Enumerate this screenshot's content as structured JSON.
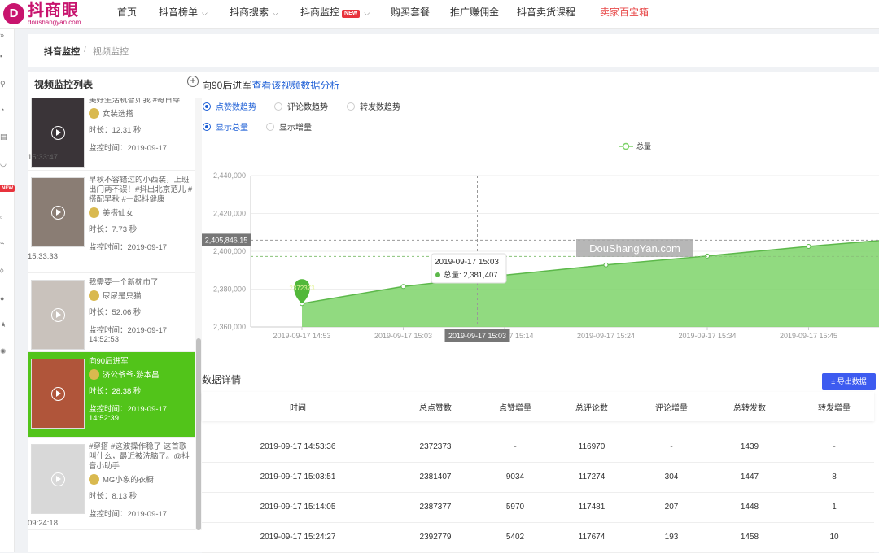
{
  "brand": {
    "name": "抖商眼",
    "sub": "doushangyan.com",
    "mark": "D"
  },
  "nav": [
    {
      "label": "首页",
      "chevron": false
    },
    {
      "label": "抖音榜单",
      "chevron": true
    },
    {
      "label": "抖商搜索",
      "chevron": true
    },
    {
      "label": "抖商监控",
      "chevron": true,
      "badge": "NEW"
    },
    {
      "label": "购买套餐",
      "chevron": false
    },
    {
      "label": "推广赚佣金",
      "chevron": false
    },
    {
      "label": "抖音卖货课程",
      "chevron": false
    },
    {
      "label": "卖家百宝箱",
      "chevron": false,
      "color": "#e84c4c"
    }
  ],
  "rail": {
    "expand": "»",
    "new_badge": "NEW"
  },
  "breadcrumb": {
    "root": "抖音监控",
    "sep": "/",
    "current": "视频监控"
  },
  "list": {
    "title": "视频监控列表",
    "add": "+",
    "items": [
      {
        "desc": "美好生活机智如我 #每日穿…",
        "author": "女装选搭",
        "duration": "时长：12.31 秒",
        "time": "监控时间：2019-09-17",
        "time2": "15:33:47",
        "active": false
      },
      {
        "desc": "早秋不容错过的小西装，上班出门两不误！#抖出北京范儿 #搭配早秋 #一起抖健康",
        "author": "美搭仙女",
        "duration": "时长：7.73 秒",
        "time": "监控时间：2019-09-17",
        "time2": "15:33:33",
        "active": false
      },
      {
        "desc": "我需要一个新枕巾了",
        "author": "尿尿是只猫",
        "duration": "时长：52.06 秒",
        "time": "监控时间：2019-09-17",
        "time2": "14:52:53",
        "active": false
      },
      {
        "desc": "向90后进军",
        "author": "济公爷爷·游本昌",
        "duration": "时长：28.38 秒",
        "time": "监控时间：2019-09-17",
        "time2": "14:52:39",
        "active": true
      },
      {
        "desc": "#穿搭 #这波操作稳了 这首歌叫什么，最近被洗脑了。@抖音小助手",
        "author": "MG小象的衣橱",
        "duration": "时长：8.13 秒",
        "time": "监控时间：2019-09-17",
        "time2": "09:24:18",
        "active": false
      }
    ]
  },
  "main": {
    "video_title": "向90后进军",
    "analysis_link": "查看该视频数据分析",
    "trend_options": [
      {
        "label": "点赞数趋势",
        "on": true
      },
      {
        "label": "评论数趋势",
        "on": false
      },
      {
        "label": "转发数趋势",
        "on": false
      }
    ],
    "mode_options": [
      {
        "label": "显示总量",
        "on": true
      },
      {
        "label": "显示增量",
        "on": false
      }
    ],
    "section_title": "数据详情",
    "export_label": "± 导出数据"
  },
  "chart_data": {
    "type": "area",
    "legend": "总量",
    "legend_position": "top-center",
    "color": "#7ed36a",
    "watermark": "DouShangYan.com",
    "x": [
      "2019-09-17 14:53",
      "2019-09-17 15:03",
      "2019-09-17 15:14",
      "2019-09-17 15:24",
      "2019-09-17 15:34",
      "2019-09-17 15:45"
    ],
    "series": [
      {
        "name": "总量",
        "values": [
          2372373,
          2381407,
          2387377,
          2392779,
          2397500,
          2402600,
          2407000
        ]
      }
    ],
    "x_points": [
      0,
      1,
      2,
      3,
      4,
      5,
      6
    ],
    "ylim": [
      2360000,
      2440000
    ],
    "yticks": [
      "2,440,000",
      "2,420,000",
      "2,400,000",
      "2,380,000",
      "2,360,000"
    ],
    "ytick_values": [
      2440000,
      2420000,
      2400000,
      2380000,
      2360000
    ],
    "tooltip": {
      "title": "2019-09-17 15:03",
      "label": "总量: 2,381,407"
    },
    "crosshair_x_label": "2019-09-17 15:03",
    "crosshair_y_label": "2,405,846.15",
    "pin_label": "2372373",
    "grid": true
  },
  "table": {
    "columns": [
      "时间",
      "总点赞数",
      "点赞增量",
      "总评论数",
      "评论增量",
      "总转发数",
      "转发增量"
    ],
    "rows": [
      [
        "2019-09-17 14:53:36",
        "2372373",
        "-",
        "116970",
        "-",
        "1439",
        "-"
      ],
      [
        "2019-09-17 15:03:51",
        "2381407",
        "9034",
        "117274",
        "304",
        "1447",
        "8"
      ],
      [
        "2019-09-17 15:14:05",
        "2387377",
        "5970",
        "117481",
        "207",
        "1448",
        "1"
      ],
      [
        "2019-09-17 15:24:27",
        "2392779",
        "5402",
        "117674",
        "193",
        "1458",
        "10"
      ]
    ]
  }
}
